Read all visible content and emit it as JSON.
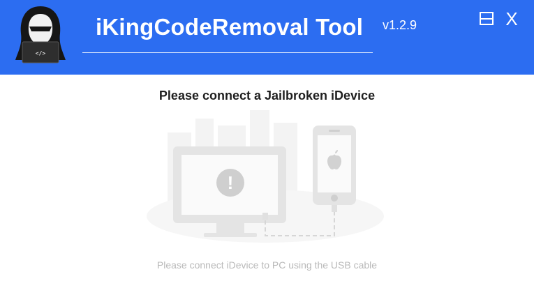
{
  "app": {
    "title": "iKingCodeRemoval Tool",
    "version": "v1.2.9",
    "logo_screen_text": "</>"
  },
  "window_controls": {
    "minimize_icon": "minimize-icon",
    "close_label": "X"
  },
  "main": {
    "prompt": "Please connect a Jailbroken iDevice",
    "hint": "Please connect iDevice to PC using the USB cable",
    "alert_symbol": "!"
  },
  "colors": {
    "header_bg": "#2c6df1",
    "illustration_gray": "#e4e4e4"
  }
}
